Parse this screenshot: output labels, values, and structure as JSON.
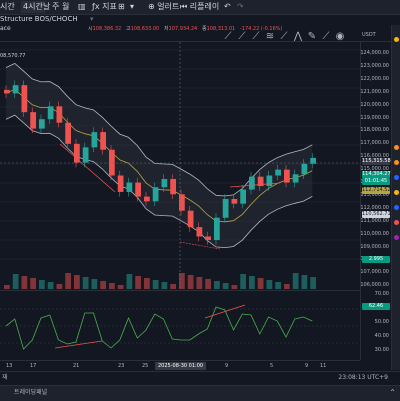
{
  "topbar": {
    "timeframe_prefix": "시간",
    "timeframe_4h": "4시간",
    "day": "날",
    "week": "주",
    "month": "월",
    "indicators_label": "지표",
    "alerts_label": "얼러트",
    "replay_label": "리플레이"
  },
  "title": {
    "indicator_name": "Structure BOS/CHOCH",
    "symbol_stub": "ace",
    "ohlc": {
      "open_label": "시",
      "open": "108,386.32",
      "high_label": "고",
      "high": "108,633.00",
      "low_label": "저",
      "low": "107,934.24",
      "close_label": "종",
      "close": "108,313.01",
      "change": "-174.22 (-0.16%)"
    },
    "currency": "USDT"
  },
  "chart": {
    "high_marker": "08,570.77",
    "osc_label_1": "3",
    "osc_label_2": "L"
  },
  "price_axis": {
    "labels": [
      "124,000.00",
      "123,000.00",
      "122,000.00",
      "121,000.00",
      "120,000.00",
      "119,000.00",
      "118,000.00",
      "117,000.00",
      "116,000.00",
      "115,000.00",
      "114,000.00",
      "113,000.00",
      "112,000.00",
      "111,000.00",
      "110,000.00",
      "109,000.00",
      "108,000.00",
      "107,000.00",
      "106,000.00"
    ],
    "current_price": "115,315.58",
    "badge_green": "114,304.27",
    "badge_green_sub": "01:01:45",
    "badge_yellow": "112,714.52",
    "badge_white": "110,562.71",
    "badge_volume": "2.995",
    "osc_labels": [
      "70.00",
      "60.00",
      "50.00",
      "40.00",
      "30.00"
    ],
    "osc_badge": "62.46"
  },
  "time_axis": {
    "labels": [
      "13",
      "17",
      "21",
      "23",
      "25",
      "27",
      "9",
      "5",
      "9",
      "11"
    ],
    "crosshair_date": "2025-08-30",
    "crosshair_time": "01:00",
    "right_label": "23:08:13 UTC+9"
  },
  "bottom": {
    "left_glyph": "재",
    "status_text": "트레이딩패널"
  },
  "colors": {
    "up": "#26a69a",
    "down": "#ef5350",
    "bb": "#d1d4dc",
    "ma": "#b5a642",
    "osc": "#4caf50"
  },
  "chart_data": {
    "type": "line",
    "title": "",
    "ylim": [
      106000,
      124500
    ],
    "series": [
      {
        "values": [
          120800,
          121500,
          119200,
          117800,
          118600,
          119700,
          118300,
          116500,
          114900,
          116200,
          117500,
          116000,
          113800,
          112400,
          113200,
          112000,
          111600,
          112800,
          113500,
          112200,
          110800,
          109400,
          108600,
          108300,
          110200,
          111800,
          111400,
          112600,
          113700,
          112900,
          113800,
          114300,
          113200,
          113900,
          114800,
          115300
        ]
      }
    ]
  }
}
